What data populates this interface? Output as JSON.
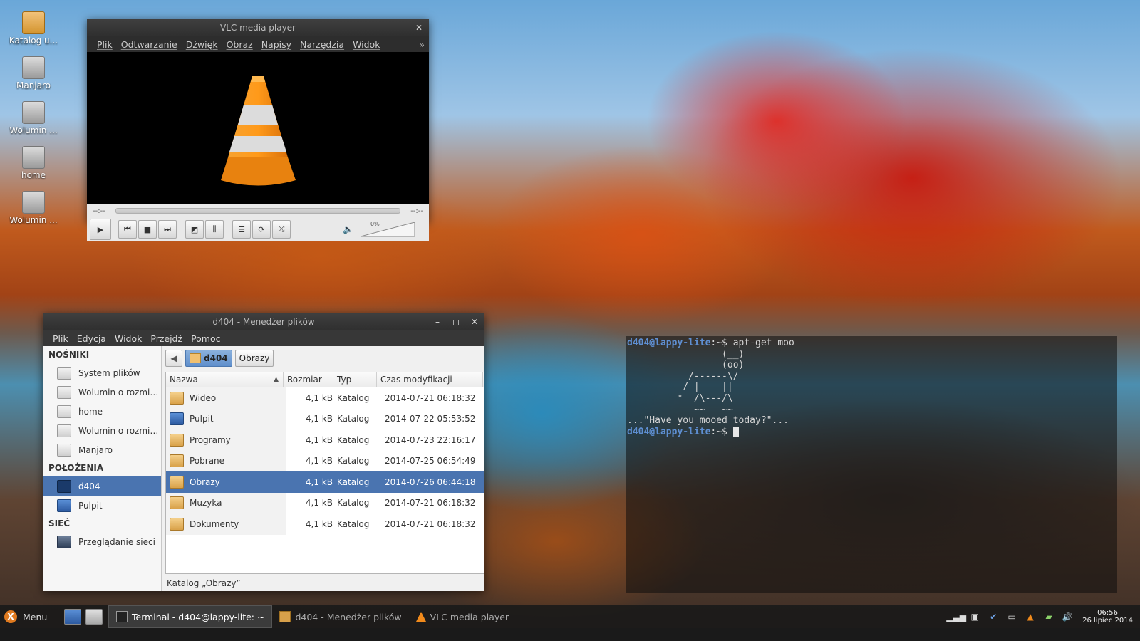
{
  "desktop": {
    "icons": [
      {
        "label": "Katalog u...",
        "icon": "home-folder-icon"
      },
      {
        "label": "Manjaro",
        "icon": "drive-icon"
      },
      {
        "label": "Wolumin ...",
        "icon": "drive-icon"
      },
      {
        "label": "home",
        "icon": "drive-icon"
      },
      {
        "label": "Wolumin ...",
        "icon": "drive-icon"
      }
    ]
  },
  "vlc": {
    "title": "VLC media player",
    "menu": [
      "Plik",
      "Odtwarzanie",
      "Dźwięk",
      "Obraz",
      "Napisy",
      "Narzędzia",
      "Widok"
    ],
    "menu_more": "»",
    "time_elapsed": "--:--",
    "time_total": "--:--",
    "volume_label": "0%",
    "volume_level": 0,
    "accent": "#f18a1b"
  },
  "filemanager": {
    "title": "d404 - Menedżer plików",
    "menu": [
      "Plik",
      "Edycja",
      "Widok",
      "Przejdź",
      "Pomoc"
    ],
    "sidebar": {
      "devices_header": "NOŚNIKI",
      "devices": [
        "System plików",
        "Wolumin o rozmiar...",
        "home",
        "Wolumin o rozmiar...",
        "Manjaro"
      ],
      "places_header": "POŁOŻENIA",
      "places": [
        "d404",
        "Pulpit"
      ],
      "network_header": "SIEĆ",
      "network": [
        "Przeglądanie sieci"
      ]
    },
    "path": [
      "d404",
      "Obrazy"
    ],
    "columns": [
      "Nazwa",
      "Rozmiar",
      "Typ",
      "Czas modyfikacji"
    ],
    "sort_indicator": "▲",
    "rows": [
      {
        "name": "Wideo",
        "size": "4,1 kB",
        "type": "Katalog",
        "modified": "2014-07-21 06:18:32"
      },
      {
        "name": "Pulpit",
        "size": "4,1 kB",
        "type": "Katalog",
        "modified": "2014-07-22 05:53:52"
      },
      {
        "name": "Programy",
        "size": "4,1 kB",
        "type": "Katalog",
        "modified": "2014-07-23 22:16:17"
      },
      {
        "name": "Pobrane",
        "size": "4,1 kB",
        "type": "Katalog",
        "modified": "2014-07-25 06:54:49"
      },
      {
        "name": "Obrazy",
        "size": "4,1 kB",
        "type": "Katalog",
        "modified": "2014-07-26 06:44:18"
      },
      {
        "name": "Muzyka",
        "size": "4,1 kB",
        "type": "Katalog",
        "modified": "2014-07-21 06:18:32"
      },
      {
        "name": "Dokumenty",
        "size": "4,1 kB",
        "type": "Katalog",
        "modified": "2014-07-21 06:18:32"
      }
    ],
    "status": "Katalog „Obrazy”",
    "selection_color": "#4a74b0"
  },
  "terminal": {
    "prompt": "d404@lappy-lite",
    "prompt_suffix": ":~$ ",
    "command": "apt-get moo",
    "moo_lines": [
      "                 (__)",
      "                 (oo)",
      "           /------\\/",
      "          / |    ||",
      "         *  /\\---/\\",
      "            ~~   ~~"
    ],
    "moo_quote": "...\"Have you mooed today?\"...",
    "prompt_color": "#5e8fd2"
  },
  "taskbar": {
    "menu_label": "Menu",
    "tasks": [
      {
        "label": "Terminal - d404@lappy-lite: ~",
        "active": true
      },
      {
        "label": "d404 - Menedżer plików",
        "active": false
      },
      {
        "label": "VLC media player",
        "active": false
      }
    ],
    "clock_time": "06:56",
    "clock_date": "26 lipiec 2014"
  }
}
